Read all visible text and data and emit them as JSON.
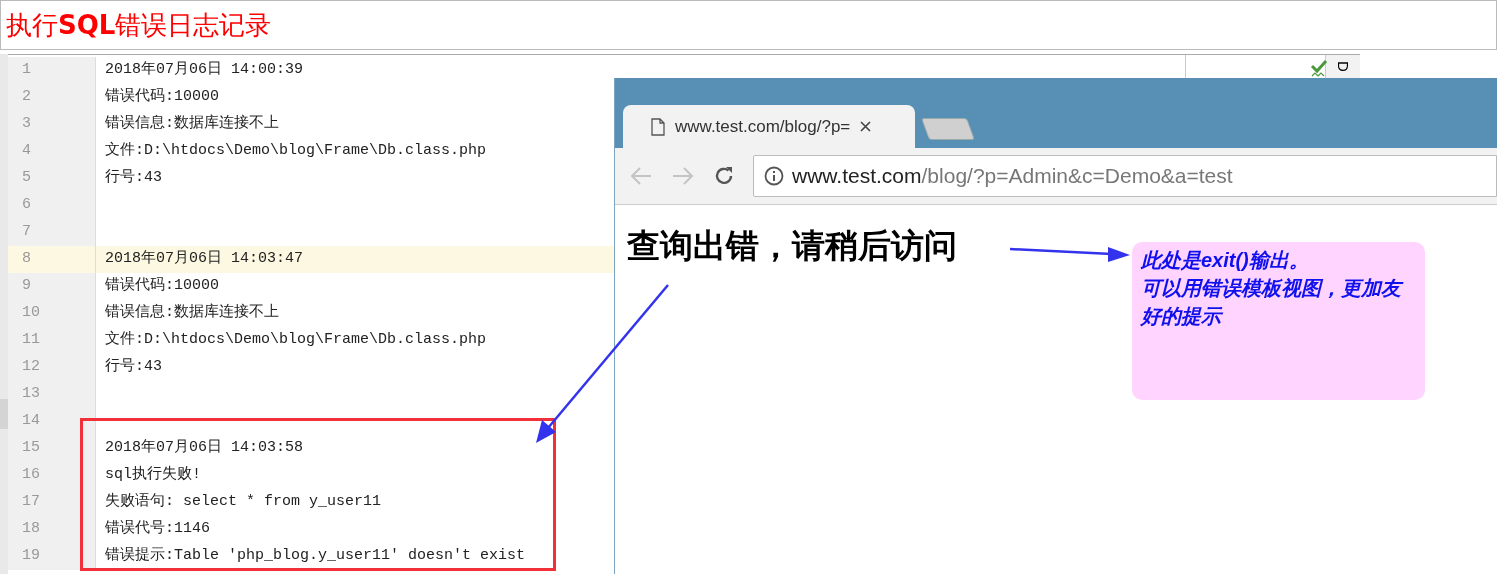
{
  "page_title": "执行**SQL**错误日志记录",
  "editor": {
    "side_tab": "D",
    "lines": [
      {
        "number": "1",
        "text": "2018年07月06日 14:00:39",
        "current": false
      },
      {
        "number": "2",
        "text": "错误代码:10000",
        "current": false
      },
      {
        "number": "3",
        "text": "错误信息:数据库连接不上",
        "current": false
      },
      {
        "number": "4",
        "text": "文件:D:\\htdocs\\Demo\\blog\\Frame\\Db.class.php",
        "current": false
      },
      {
        "number": "5",
        "text": "行号:43",
        "current": false
      },
      {
        "number": "6",
        "current": false
      },
      {
        "number": "7",
        "current": false
      },
      {
        "number": "8",
        "text": "2018年07月06日 14:03:47",
        "current": true
      },
      {
        "number": "9",
        "text": "错误代码:10000",
        "current": false
      },
      {
        "number": "10",
        "text": "错误信息:数据库连接不上",
        "current": false
      },
      {
        "number": "11",
        "text": "文件:D:\\htdocs\\Demo\\blog\\Frame\\Db.class.php",
        "current": false
      },
      {
        "number": "12",
        "text": "行号:43",
        "current": false
      },
      {
        "number": "13",
        "current": false
      },
      {
        "number": "14",
        "current": false
      },
      {
        "number": "15",
        "text": "2018年07月06日 14:03:58",
        "current": false
      },
      {
        "number": "16",
        "text": "sql执行失败!",
        "current": false
      },
      {
        "number": "17",
        "text": "失败语句: select * from y_user11",
        "current": false
      },
      {
        "number": "18",
        "text": "错误代号:1146",
        "current": false
      },
      {
        "number": "19",
        "text": "错误提示:Table 'php_blog.y_user11' doesn't exist",
        "current": false
      }
    ]
  },
  "browser": {
    "tabs": [
      {
        "title": "www.test.com/blog/?p=",
        "selected": true
      },
      {
        "selected": false
      }
    ],
    "back_disabled": true,
    "forward_disabled": true,
    "address": {
      "host": "www.test.com",
      "path": "/blog/?p=Admin&c=Demo&a=test"
    },
    "page_heading": "查询出错，请稍后访问"
  },
  "annotation": {
    "lines": [
      "此处是exit()输出。",
      "可以用错误模板视图，更加友好的提示"
    ]
  }
}
